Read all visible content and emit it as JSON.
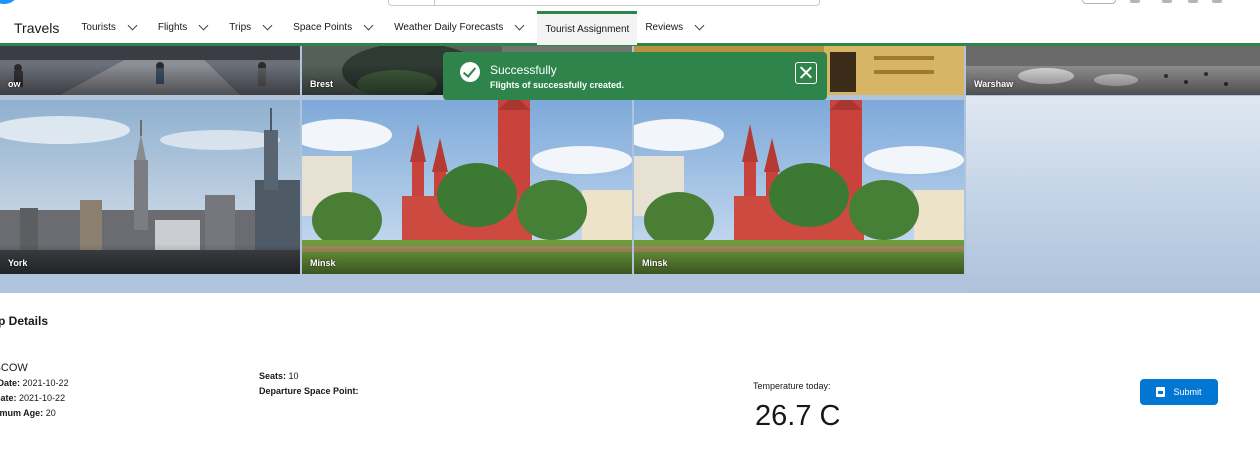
{
  "app": {
    "name": "Travels"
  },
  "nav": {
    "items": [
      {
        "label": "Tourists",
        "has_menu": true
      },
      {
        "label": "Flights",
        "has_menu": true
      },
      {
        "label": "Trips",
        "has_menu": true
      },
      {
        "label": "Space Points",
        "has_menu": true
      },
      {
        "label": "Weather Daily Forecasts",
        "has_menu": true
      },
      {
        "label": "Tourist Assignment",
        "has_menu": false,
        "active": true
      },
      {
        "label": "Reviews",
        "has_menu": true
      }
    ]
  },
  "gallery": {
    "tiles": [
      {
        "label": "ow"
      },
      {
        "label": "Brest"
      },
      {
        "label": ""
      },
      {
        "label": "Warshaw"
      },
      {
        "label": "York"
      },
      {
        "label": "Minsk"
      },
      {
        "label": "Minsk"
      }
    ]
  },
  "toast": {
    "title": "Successfully",
    "message": "Flights of successfully created.",
    "color": "#2e844a"
  },
  "trip": {
    "title": "rip Details",
    "city": "OSCOW",
    "start_label": "t Date:",
    "start_value": "2021-10-22",
    "end_label": "Date:",
    "end_value": "2021-10-22",
    "min_age_label": "imum Age:",
    "min_age_value": "20",
    "seats_label": "Seats:",
    "seats_value": "10",
    "departure_label": "Departure Space Point:",
    "departure_value": ""
  },
  "weather": {
    "label": "Temperature today:",
    "value": "26.7 C"
  },
  "actions": {
    "submit_label": "Submit",
    "color": "#0176d3"
  }
}
